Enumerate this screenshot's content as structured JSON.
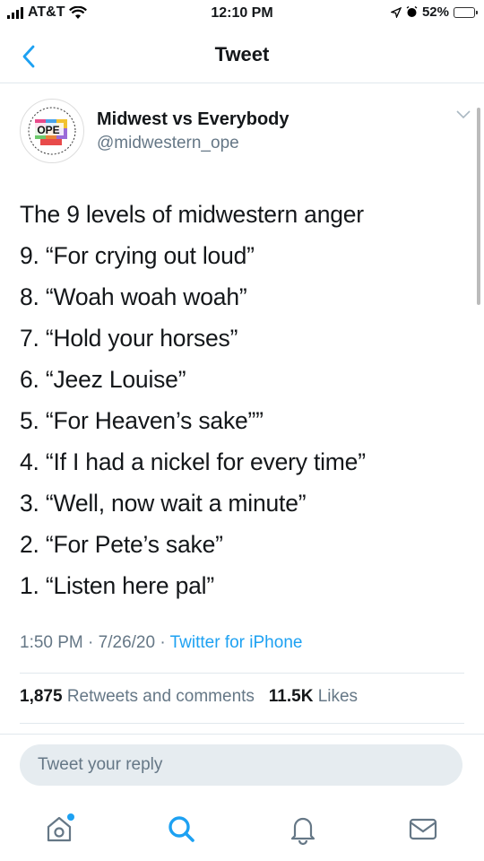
{
  "status_bar": {
    "carrier": "AT&T",
    "time": "12:10 PM",
    "battery": "52%",
    "battery_level": 0.52
  },
  "nav": {
    "title": "Tweet"
  },
  "author": {
    "name": "Midwest vs Everybody",
    "handle": "@midwestern_ope",
    "avatar_text": "OPE"
  },
  "tweet": {
    "title": "The 9 levels of midwestern anger",
    "lines": [
      "9. “For crying out loud”",
      "8. “Woah woah woah”",
      "7. “Hold your horses”",
      "6. “Jeez Louise”",
      "5. “For Heaven’s sake””",
      "4. “If I had a nickel for every time”",
      "3. “Well, now wait a minute”",
      "2. “For Pete’s sake”",
      "1. “Listen here pal”"
    ],
    "time": "1:50 PM",
    "date": "7/26/20",
    "source": "Twitter for iPhone"
  },
  "stats": {
    "retweets_count": "1,875",
    "retweets_label": "Retweets and comments",
    "likes_count": "11.5K",
    "likes_label": "Likes"
  },
  "reply": {
    "placeholder": "Tweet your reply"
  },
  "tabs": [
    {
      "icon": "home-icon"
    },
    {
      "icon": "search-icon"
    },
    {
      "icon": "notifications-icon"
    },
    {
      "icon": "messages-icon"
    }
  ],
  "colors": {
    "accent": "#1da1f2",
    "secondary_text": "#657786",
    "battery": "#f5d200"
  }
}
